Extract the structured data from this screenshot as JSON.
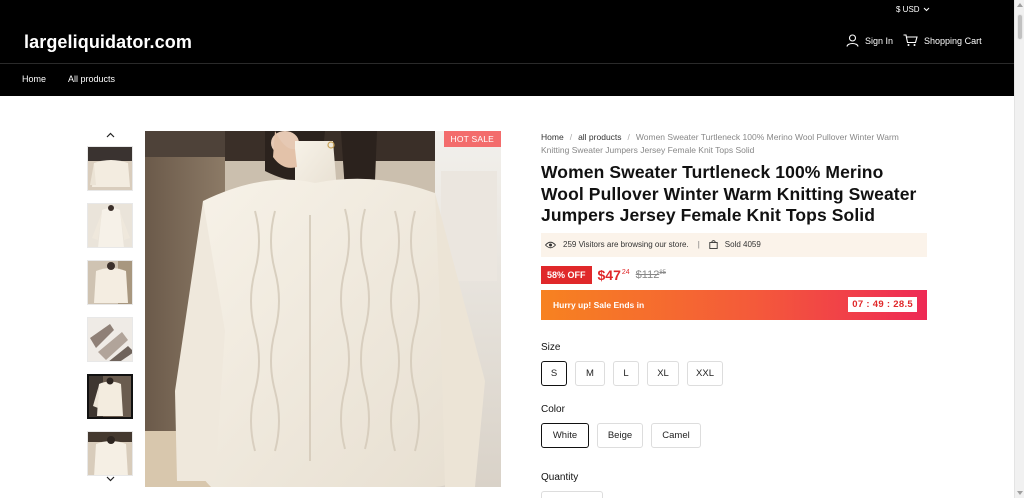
{
  "header": {
    "currency": "$ USD",
    "logo": "largeliquidator.com",
    "sign_in": "Sign In",
    "cart": "Shopping Cart",
    "nav": [
      "Home",
      "All products"
    ]
  },
  "gallery": {
    "badge": "HOT SALE",
    "thumbnail_count": 6,
    "active_thumbnail_index": 4
  },
  "product": {
    "breadcrumb": {
      "home": "Home",
      "all": "all products",
      "current": "Women Sweater Turtleneck 100% Merino Wool Pullover Winter Warm Knitting Sweater Jumpers Jersey Female Knit Tops Solid"
    },
    "title": "Women Sweater Turtleneck 100% Merino Wool Pullover Winter Warm Knitting Sweater Jumpers Jersey Female Knit Tops Solid",
    "visitors": "259 Visitors are browsing our store.",
    "separator": "|",
    "sold": "Sold 4059",
    "discount": "58% OFF",
    "price_main": "$47",
    "price_cents": "24",
    "old_price_main": "$112",
    "old_price_cents": "85",
    "hurry_text": "Hurry up! Sale Ends in",
    "timer": "07 : 49 : 28.5",
    "size_label": "Size",
    "sizes": [
      "S",
      "M",
      "L",
      "XL",
      "XXL"
    ],
    "selected_size": "S",
    "color_label": "Color",
    "colors": [
      "White",
      "Beige",
      "Camel"
    ],
    "selected_color": "White",
    "quantity_label": "Quantity"
  },
  "colors": {
    "header_bg": "#000000",
    "accent_red": "#e0282a",
    "badge_pink": "#f36c6c",
    "gradient_start": "#f78220",
    "gradient_end": "#ee2a55",
    "visitor_bg": "#fbf3ea"
  }
}
